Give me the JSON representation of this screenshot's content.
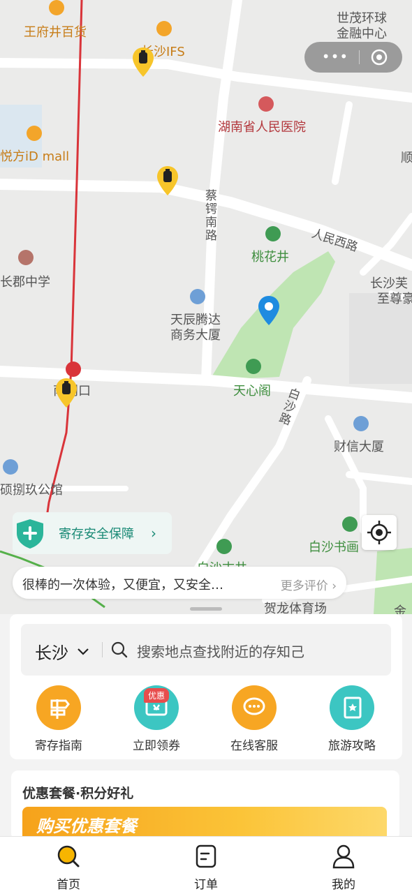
{
  "map": {
    "pois": {
      "wangfujing": "王府井百货",
      "ifs": "长沙IFS",
      "shijie_line1": "世茂环球",
      "shijie_line2": "金融中心",
      "hospital": "湖南省人民医院",
      "yuefang": "悦方iD mall",
      "shun": "顺",
      "caie_road": "蔡锷南路",
      "renminxi_road": "人民西路",
      "taohuajing": "桃花井",
      "changjun": "长郡中学",
      "changsha_fu_line1": "长沙芙",
      "changsha_fu_line2": "至尊豪",
      "tianchen_line1": "天辰腾达",
      "tianchen_line2": "商务大厦",
      "tianxinge": "天心阁",
      "station": "南门口",
      "baisha_road": "白沙路",
      "caixin": "财信大厦",
      "gongguan": "硕捌玖公馆",
      "baisha_shuhua": "白沙书画",
      "baisha_jing": "白沙古井",
      "helong": "贺龙体育场",
      "jin": "金"
    }
  },
  "capsule": {
    "more_label": "•••"
  },
  "guarantee": {
    "label": "寄存安全保障",
    "chevron": "›"
  },
  "review": {
    "text": "很棒的一次体验，又便宜，又安全…",
    "more": "更多评价 ›"
  },
  "search": {
    "city": "长沙",
    "placeholder": "搜索地点查找附近的存知己"
  },
  "actions": [
    {
      "label": "寄存指南",
      "color": "#f7a623"
    },
    {
      "label": "立即领券",
      "color": "#3cc6c2",
      "badge": "优惠"
    },
    {
      "label": "在线客服",
      "color": "#f7a623"
    },
    {
      "label": "旅游攻略",
      "color": "#3cc6c2"
    }
  ],
  "promo": {
    "title": "优惠套餐·积分好礼",
    "banner_text": "购买优惠套餐"
  },
  "tabs": [
    {
      "label": "首页",
      "active": true
    },
    {
      "label": "订单",
      "active": false
    },
    {
      "label": "我的",
      "active": false
    }
  ],
  "colors": {
    "accent": "#f7b500",
    "teal": "#1a8a76",
    "pin_blue": "#1e8be0"
  }
}
